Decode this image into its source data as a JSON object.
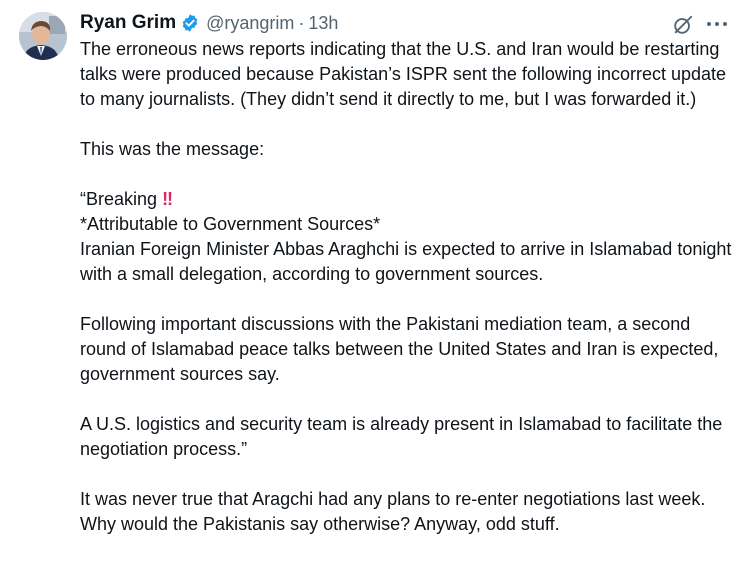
{
  "author": {
    "display_name": "Ryan Grim",
    "handle": "@ryangrim",
    "separator": "·",
    "time": "13h",
    "avatar_icon": "profile-photo",
    "verified_icon": "verified-badge-icon",
    "verified_color": "#1d9bf0"
  },
  "actions": {
    "grok_icon": "grok-icon",
    "more_icon": "more-options-icon"
  },
  "tweet": {
    "intro": "The erroneous news reports indicating that the U.S. and Iran would be restarting talks were produced because Pakistan’s ISPR sent the following incorrect update to many journalists. (They didn’t send it directly to me, but I was forwarded it.)",
    "lead_in": "This was the message:",
    "quote_open": "“Breaking",
    "quote_emoji": "‼",
    "attribution": "*Attributable to Government Sources*",
    "para1": "Iranian Foreign Minister Abbas Araghchi is expected to arrive in Islamabad tonight with a small delegation, according to government sources.",
    "para2": "Following important discussions with the Pakistani mediation team, a second round of Islamabad peace talks between the United States and Iran is expected, government sources say.",
    "para3": "A U.S. logistics and security team is already present in Islamabad to facilitate the negotiation process.”",
    "closing": "It was never true that Aragchi had any plans to re-enter negotiations last week. Why would the Pakistanis say otherwise? Anyway, odd stuff."
  },
  "colors": {
    "text": "#0f1419",
    "secondary": "#536471",
    "emoji_red": "#e0245e"
  }
}
